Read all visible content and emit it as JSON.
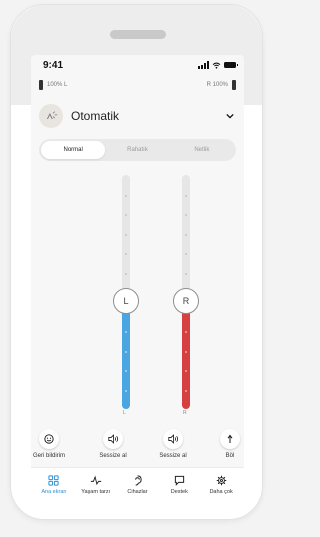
{
  "status_bar": {
    "time": "9:41"
  },
  "battery": {
    "left_text": "100% L",
    "right_text": "R 100%",
    "left_level": 1.0,
    "right_level": 1.0
  },
  "program": {
    "name": "Otomatik",
    "icon": "program-auto-icon"
  },
  "segments": [
    {
      "label": "Normal",
      "active": true
    },
    {
      "label": "Rahatık",
      "active": false
    },
    {
      "label": "Netlik",
      "active": false
    }
  ],
  "sliders": {
    "left": {
      "label": "L",
      "end_label": "L",
      "level": 0.46,
      "color": "#4aa5e0",
      "icon": "slider-knob"
    },
    "right": {
      "label": "R",
      "end_label": "R",
      "level": 0.46,
      "color": "#d64040",
      "icon": "slider-knob"
    }
  },
  "actions": [
    {
      "label": "Geri bildirim",
      "icon": "smiley-icon"
    },
    {
      "label": "Sessize al",
      "icon": "speaker-icon"
    },
    {
      "label": "Sessize al",
      "icon": "speaker-icon"
    },
    {
      "label": "Böl",
      "icon": "split-icon"
    }
  ],
  "tabs": [
    {
      "label": "Ana ekran",
      "icon": "home-grid-icon",
      "active": true
    },
    {
      "label": "Yaşam tarzı",
      "icon": "pulse-icon",
      "active": false
    },
    {
      "label": "Cihazlar",
      "icon": "hearing-aid-icon",
      "active": false
    },
    {
      "label": "Destek",
      "icon": "chat-icon",
      "active": false
    },
    {
      "label": "Daha çok",
      "icon": "gear-icon",
      "active": false
    }
  ],
  "colors": {
    "accent": "#2f8fd6",
    "left": "#4aa5e0",
    "right": "#d64040"
  }
}
